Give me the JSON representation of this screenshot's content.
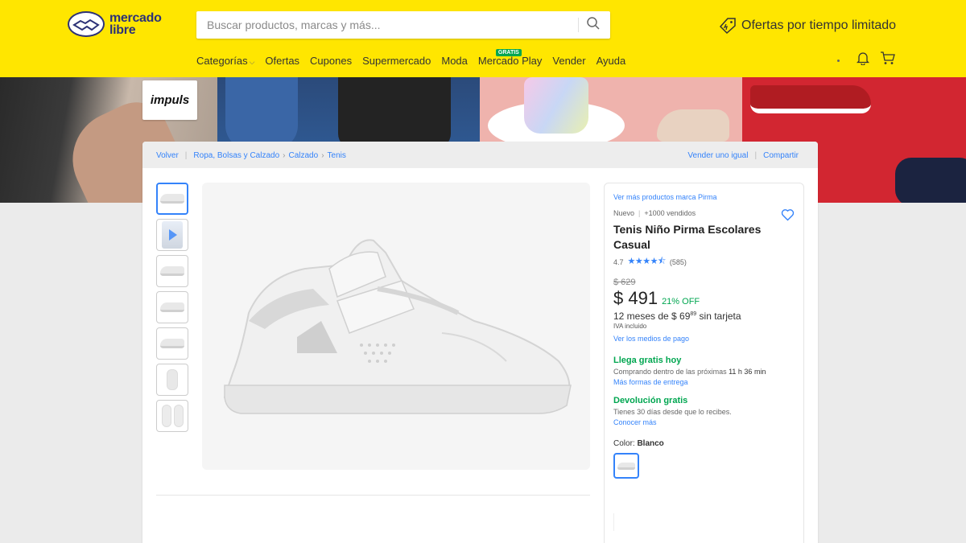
{
  "header": {
    "logo_line1": "mercado",
    "logo_line2": "libre",
    "search_placeholder": "Buscar productos, marcas y más...",
    "promo_text": "Ofertas por tiempo limitado",
    "nav": [
      {
        "label": "Categorías"
      },
      {
        "label": "Ofertas"
      },
      {
        "label": "Cupones"
      },
      {
        "label": "Supermercado"
      },
      {
        "label": "Moda"
      },
      {
        "label": "Mercado Play",
        "badge": "GRATIS"
      },
      {
        "label": "Vender"
      },
      {
        "label": "Ayuda"
      }
    ],
    "brand_color": "#ffe600"
  },
  "banner": {
    "store_logo": "impuls"
  },
  "breadcrumb": {
    "back": "Volver",
    "items": [
      "Ropa, Bolsas y Calzado",
      "Calzado",
      "Tenis"
    ],
    "sell_similar": "Vender uno igual",
    "share": "Compartir"
  },
  "product": {
    "brand_link": "Ver más productos marca Pirma",
    "condition": "Nuevo",
    "sold": "+1000 vendidos",
    "title": "Tenis Niño Pirma Escolares Casual",
    "rating_value": "4.7",
    "stars": "★★★★⯪",
    "reviews": "(585)",
    "old_price": "$ 629",
    "price": "$ 491",
    "discount": "21% OFF",
    "installments_prefix": "12 meses de $ 69",
    "installments_cents": "89",
    "installments_suffix": " sin tarjeta",
    "tax_note": "IVA incluido",
    "payment_link": "Ver los medios de pago",
    "shipping_title": "Llega gratis hoy",
    "shipping_text": "Comprando dentro de las próximas ",
    "shipping_time": "11 h 36 min",
    "shipping_link": "Más formas de entrega",
    "return_title": "Devolución gratis",
    "return_text": "Tienes 30 días desde que lo recibes.",
    "return_link": "Conocer más",
    "color_label": "Color: ",
    "color_value": "Blanco"
  },
  "colors": {
    "accent": "#3483fa",
    "green": "#00a650"
  }
}
